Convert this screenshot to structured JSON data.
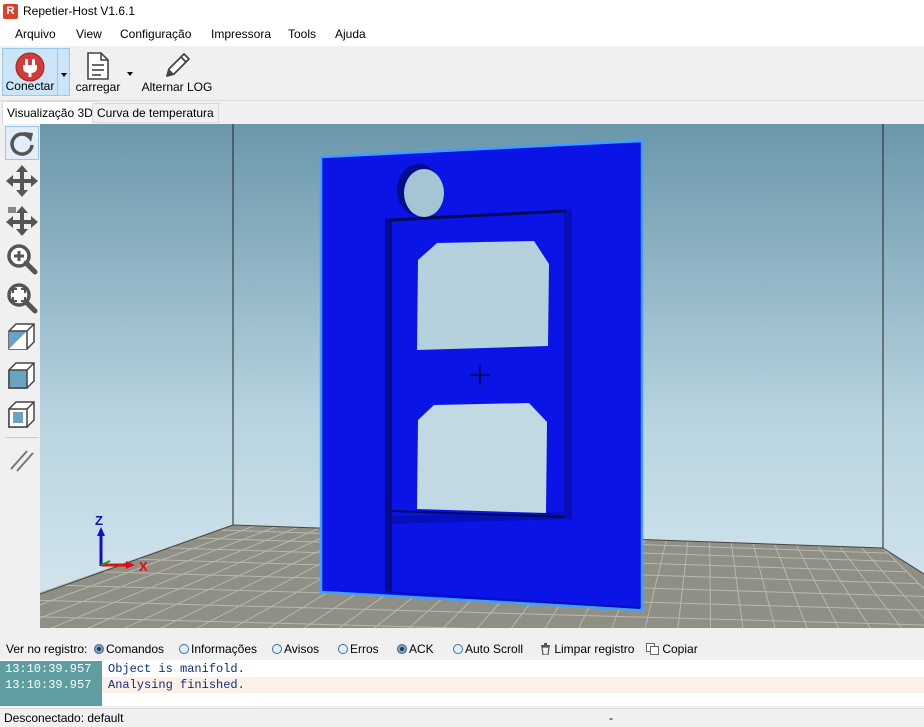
{
  "window": {
    "title": "Repetier-Host V1.6.1",
    "icon_letter": "R"
  },
  "menu": [
    "Arquivo",
    "View",
    "Configuração",
    "Impressora",
    "Tools",
    "Ajuda"
  ],
  "toolbar": {
    "connect": "Conectar",
    "load": "carregar",
    "toggle_log": "Alternar LOG"
  },
  "tabs": [
    "Visualização 3D",
    "Curva de temperatura"
  ],
  "viewport": {
    "axis_z": "Z",
    "axis_x": "X"
  },
  "log_filter": {
    "label": "Ver no registro:",
    "options": [
      {
        "label": "Comandos",
        "checked": true
      },
      {
        "label": "Informações",
        "checked": false
      },
      {
        "label": "Avisos",
        "checked": false
      },
      {
        "label": "Erros",
        "checked": false
      },
      {
        "label": "ACK",
        "checked": true
      },
      {
        "label": "Auto Scroll",
        "checked": false
      }
    ],
    "clear": "Limpar registro",
    "copy": "Copiar"
  },
  "log": [
    {
      "time": "13:10:39.957",
      "message": "Object is manifold."
    },
    {
      "time": "13:10:39.957",
      "message": "Analysing finished."
    }
  ],
  "status": {
    "left": "Desconectado: default",
    "middle": "-"
  },
  "colors": {
    "model": "#0a14e6",
    "model_outline": "#3da0ff",
    "log_time_bg": "#5f9ea0",
    "log_text": "#0a2d8a"
  }
}
